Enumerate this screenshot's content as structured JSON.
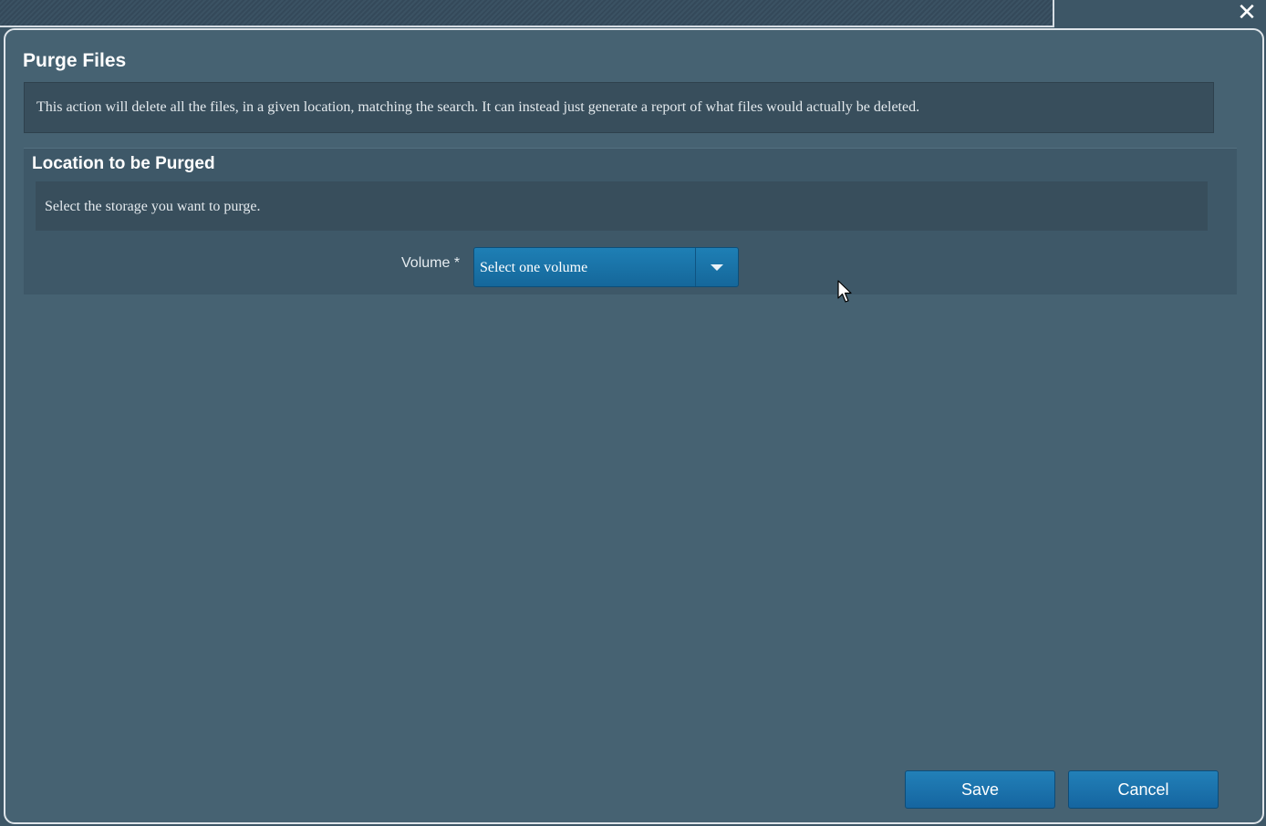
{
  "window": {
    "close_glyph": "✕"
  },
  "dialog": {
    "title": "Purge Files",
    "description": "This action will delete all the files, in a given location, matching the search. It can instead just generate a report of what files would actually be deleted."
  },
  "location_section": {
    "title": "Location to be Purged",
    "description": "Select the storage you want to purge.",
    "volume_label": "Volume *",
    "volume_select": {
      "selected": "Select one volume"
    }
  },
  "footer": {
    "save_label": "Save",
    "cancel_label": "Cancel"
  },
  "colors": {
    "background": "#3d5666",
    "dialog": "#466272",
    "panel": "#384e5c",
    "accent": "#1e7fb5"
  },
  "icons": {
    "close": "close-icon",
    "dropdown": "chevron-down-icon",
    "pointer": "mouse-cursor-icon"
  }
}
